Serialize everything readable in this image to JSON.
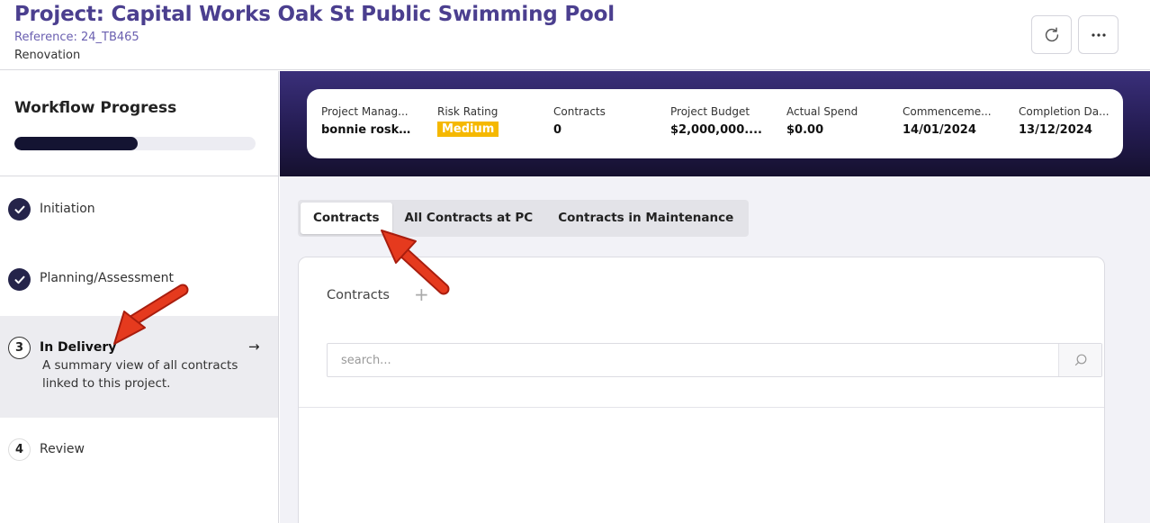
{
  "header": {
    "title": "Project: Capital Works Oak St Public Swimming Pool",
    "reference": "Reference: 24_TB465",
    "type": "Renovation",
    "refresh_icon": "refresh-icon",
    "more_icon": "more-horizontal-icon"
  },
  "workflow": {
    "title": "Workflow Progress",
    "progress_percent": 51,
    "steps": [
      {
        "marker": "check",
        "label": "Initiation",
        "status": "completed"
      },
      {
        "marker": "check",
        "label": "Planning/Assessment",
        "status": "completed"
      },
      {
        "marker": "3",
        "label": "In Delivery",
        "status": "active",
        "description": "A summary view of all contracts linked to this project."
      },
      {
        "marker": "4",
        "label": "Review",
        "status": "pending"
      }
    ],
    "active_arrow": "→"
  },
  "summary": {
    "items": [
      {
        "label": "Project Manag...",
        "value": "bonnie rosk..."
      },
      {
        "label": "Risk Rating",
        "value": "Medium",
        "badge_color": "#f5b800"
      },
      {
        "label": "Contracts",
        "value": "0"
      },
      {
        "label": "Project Budget",
        "value": "$2,000,000...."
      },
      {
        "label": "Actual Spend",
        "value": "$0.00"
      },
      {
        "label": "Commenceme...",
        "value": "14/01/2024"
      },
      {
        "label": "Completion Da...",
        "value": "13/12/2024"
      }
    ]
  },
  "tabs": [
    {
      "label": "Contracts",
      "active": true
    },
    {
      "label": "All Contracts at PC",
      "active": false
    },
    {
      "label": "Contracts in Maintenance",
      "active": false
    }
  ],
  "contracts_panel": {
    "title": "Contracts",
    "add_symbol": "+",
    "search_placeholder": "search..."
  },
  "colors": {
    "title": "#4b3f8f",
    "banner_top": "#3a2f7a",
    "banner_bottom": "#15102e",
    "progress_fill": "#141432",
    "annotation_arrow": "#e53a1e"
  }
}
